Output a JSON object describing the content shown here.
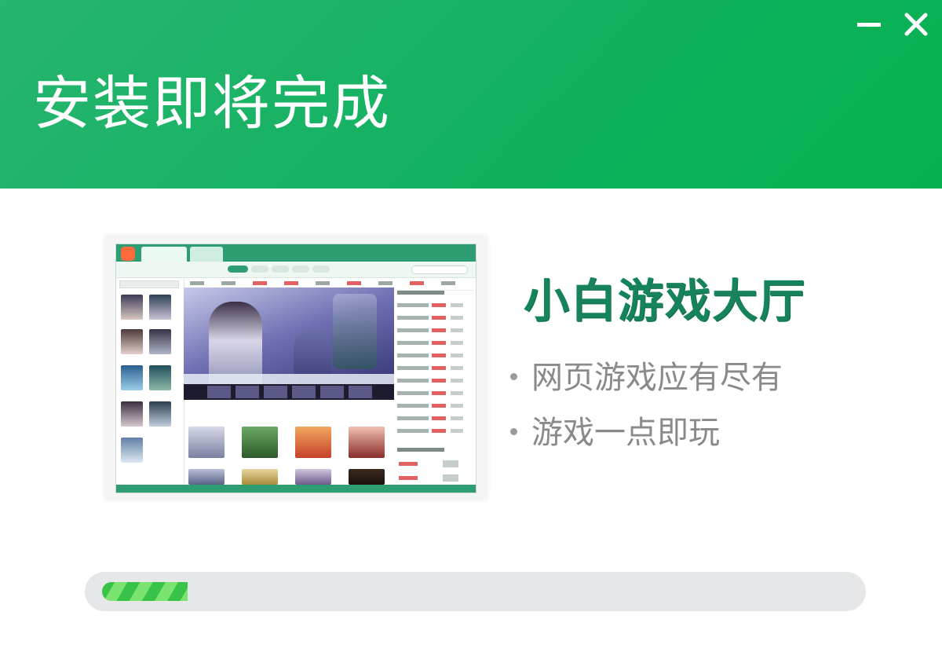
{
  "window": {
    "title": "安装即将完成",
    "minimize_icon": "minus-icon",
    "close_icon": "close-x-icon"
  },
  "promo": {
    "brand": "小白游戏大厅",
    "bullets": [
      "网页游戏应有尽有",
      "游戏一点即玩"
    ]
  },
  "progress": {
    "fraction": 0.115
  },
  "colors": {
    "header_green": "#0fb25d",
    "brand_green": "#16835a",
    "progress_green": "#37c34a"
  }
}
